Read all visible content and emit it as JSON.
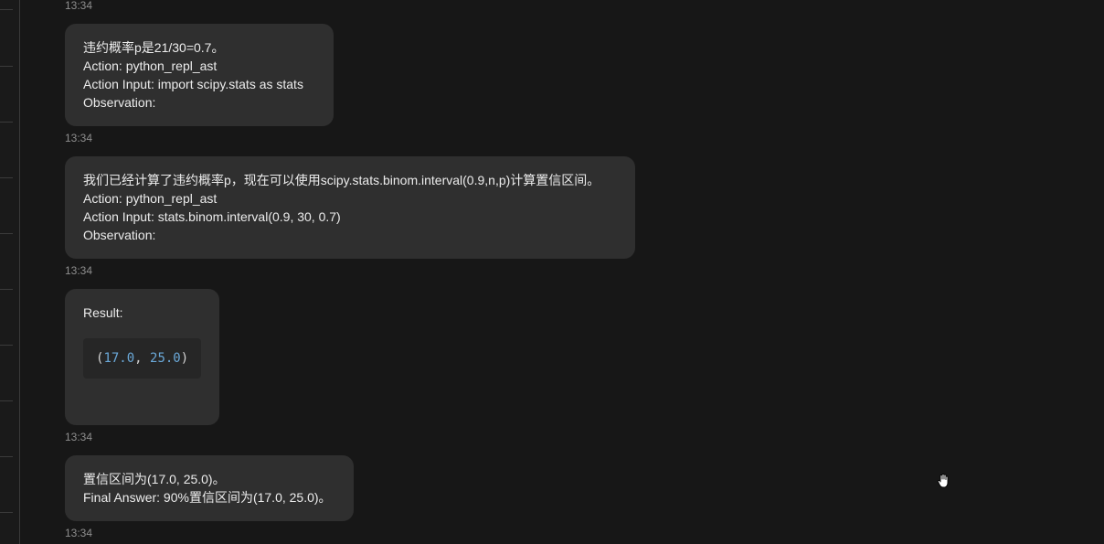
{
  "messages": [
    {
      "time_before": "13:34",
      "lines": [
        "违约概率p是21/30=0.7。",
        "Action: python_repl_ast",
        "Action Input: import scipy.stats as stats",
        "Observation:"
      ]
    },
    {
      "time_before": "13:34",
      "lines": [
        "我们已经计算了违约概率p，现在可以使用scipy.stats.binom.interval(0.9,n,p)计算置信区间。",
        "Action: python_repl_ast",
        "Action Input: stats.binom.interval(0.9, 30, 0.7)",
        "Observation:"
      ]
    },
    {
      "time_before": "13:34",
      "result_label": "Result:",
      "code": {
        "open": "(",
        "first": "17.0",
        "sep": ", ",
        "second": "25.0",
        "close": ")"
      }
    },
    {
      "time_before": "13:34",
      "lines": [
        "置信区间为(17.0, 25.0)。",
        "Final Answer: 90%置信区间为(17.0, 25.0)。"
      ]
    }
  ],
  "last_time": "13:34",
  "cursor_icon": "hand-grab-icon"
}
